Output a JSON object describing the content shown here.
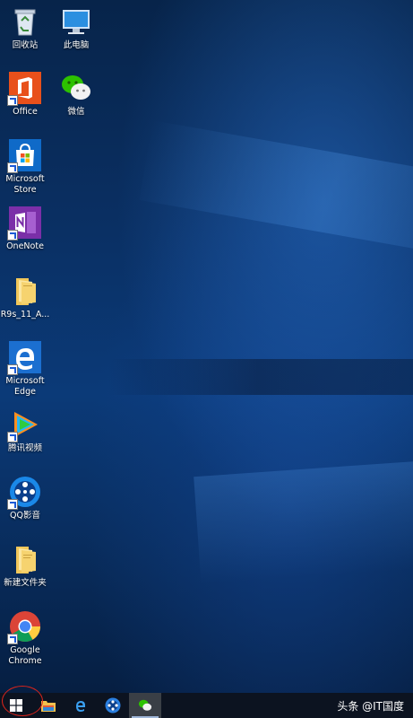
{
  "desktop": {
    "icons": {
      "recycle_bin": "回收站",
      "this_pc": "此电脑",
      "office": "Office",
      "wechat": "微信",
      "microsoft_store": "Microsoft Store",
      "onenote": "OneNote",
      "folder_r9s": "R9s_11_A...",
      "microsoft_edge": "Microsoft Edge",
      "tencent_video": "腾讯视频",
      "qq_player": "QQ影音",
      "new_folder": "新建文件夹",
      "google_chrome": "Google Chrome"
    }
  },
  "taskbar": {
    "items": [
      "windows-start-icon",
      "file-explorer-icon",
      "edge-icon",
      "qq-music-icon",
      "wechat-icon"
    ],
    "active_item": "wechat-icon"
  },
  "watermark": "头条 @IT国度",
  "colors": {
    "taskbar": "#0c1320",
    "annotation_circle": "#d9241b"
  }
}
